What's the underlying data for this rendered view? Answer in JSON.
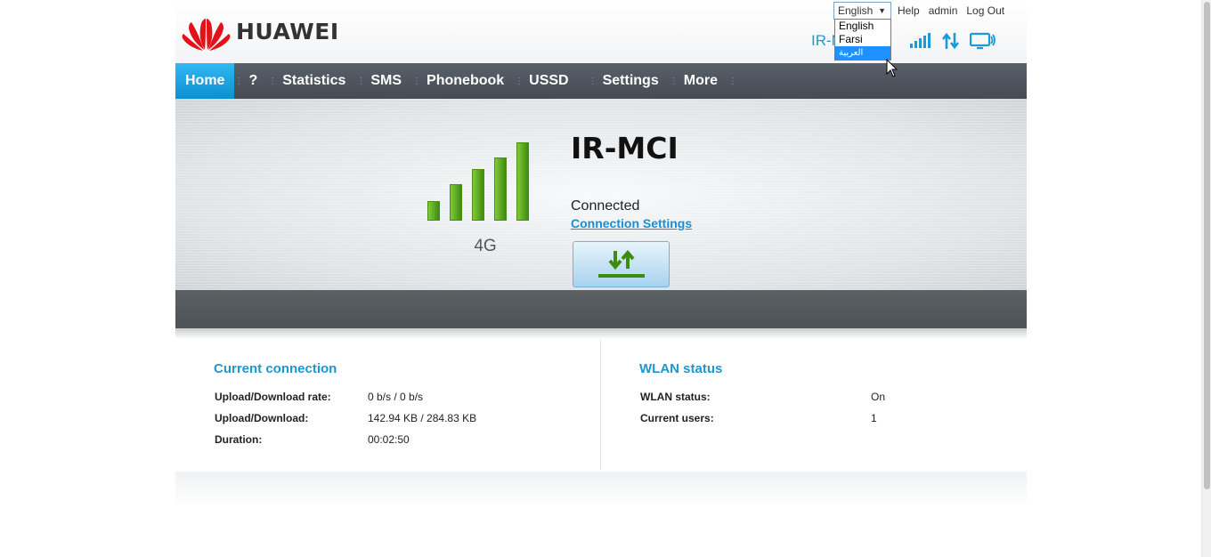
{
  "header": {
    "brand": "HUAWEI",
    "language": {
      "selected": "English",
      "options": [
        "English",
        "Farsi",
        "العربية"
      ]
    },
    "links": {
      "help": "Help",
      "admin": "admin",
      "logout": "Log Out"
    },
    "status_operator": "IR-MCI 4G",
    "icons": [
      "signal-icon",
      "data-transfer-icon",
      "device-icon"
    ]
  },
  "nav": {
    "items": [
      {
        "id": "home",
        "label": "Home"
      },
      {
        "id": "help",
        "label": "?"
      },
      {
        "id": "statistics",
        "label": "Statistics"
      },
      {
        "id": "sms",
        "label": "SMS"
      },
      {
        "id": "phonebook",
        "label": "Phonebook"
      },
      {
        "id": "ussd",
        "label": "USSD"
      },
      {
        "id": "settings",
        "label": "Settings"
      },
      {
        "id": "more",
        "label": "More"
      }
    ]
  },
  "hero": {
    "signal_level": 5,
    "signal_max": 5,
    "network_type": "4G",
    "operator": "IR-MCI",
    "connection_state": "Connected",
    "connection_settings_label": "Connection Settings"
  },
  "current_connection": {
    "title": "Current connection",
    "rows": [
      {
        "label": "Upload/Download rate:",
        "value": "0 b/s / 0 b/s"
      },
      {
        "label": "Upload/Download:",
        "value": "142.94 KB / 284.83 KB"
      },
      {
        "label": "Duration:",
        "value": "00:02:50"
      }
    ]
  },
  "wlan": {
    "title": "WLAN status",
    "rows": [
      {
        "label": "WLAN status:",
        "value": "On"
      },
      {
        "label": "Current users:",
        "value": "1"
      }
    ]
  },
  "colors": {
    "accent": "#1a9ad6",
    "nav_active": "#1ea5e4",
    "signal": "#5aa51e"
  }
}
